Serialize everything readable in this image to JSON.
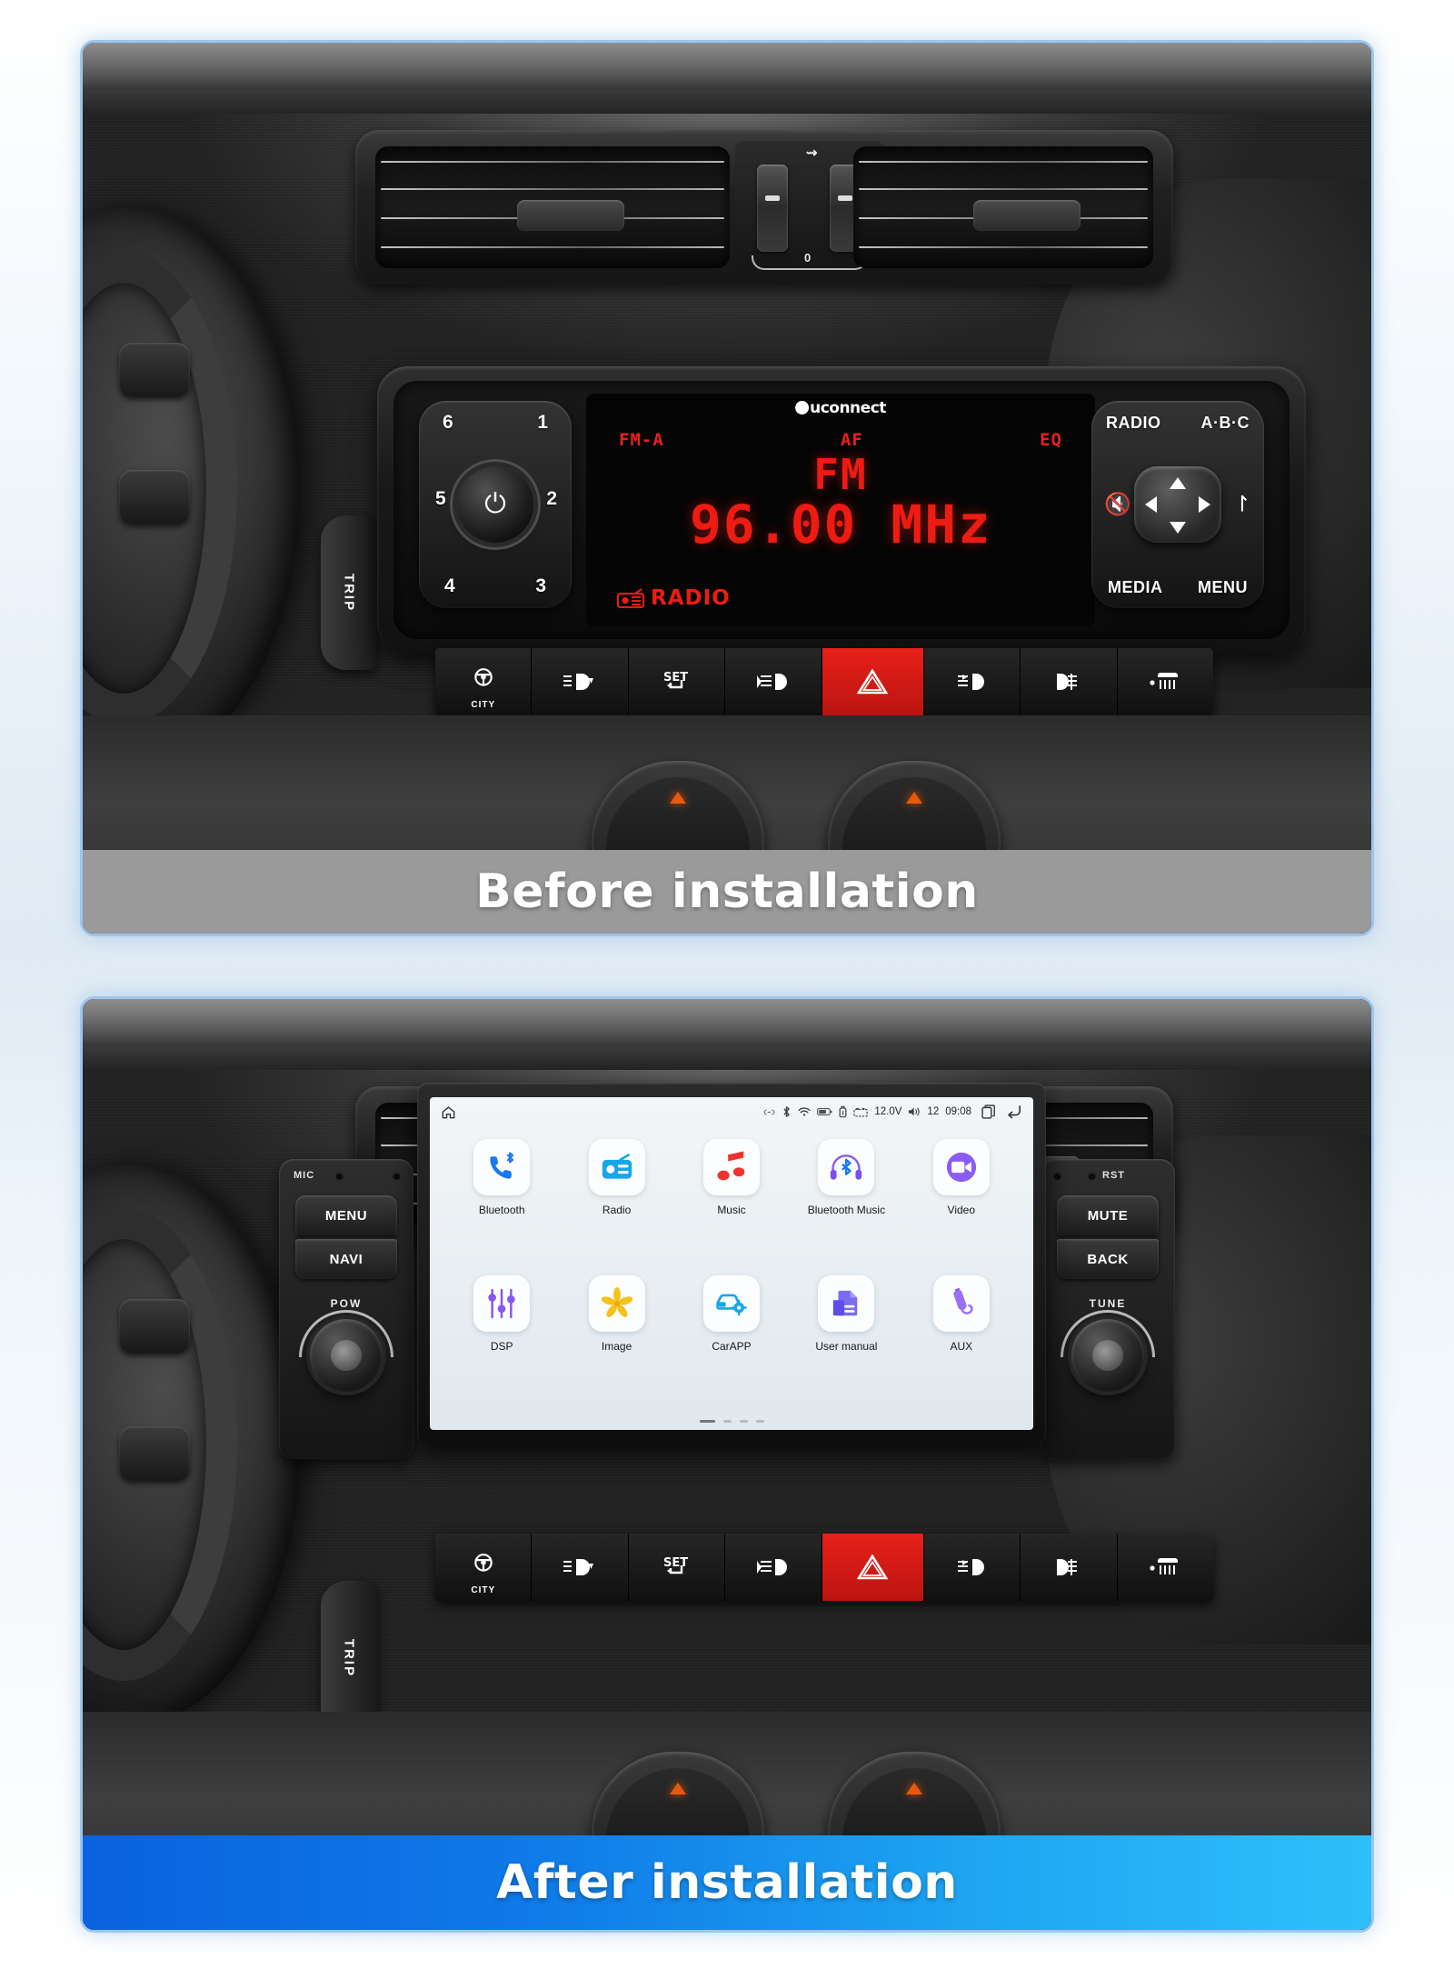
{
  "captions": {
    "before": "Before installation",
    "after": "After installation"
  },
  "colors": {
    "card_border": "#9cc6ee",
    "caption_before_bg": "#9a9a9a",
    "caption_after_bg_start": "#0a62e0",
    "caption_after_bg_end": "#2ec0fb",
    "lcd_red": "#ee1b12",
    "hazard_red": "#e8201a"
  },
  "stock_radio": {
    "brand": "uconnect",
    "display": {
      "tags": [
        "FM-A",
        "AF",
        "EQ"
      ],
      "band": "FM",
      "frequency": "96.00 MHz",
      "source_label": "RADIO"
    },
    "preset_numbers": [
      "1",
      "2",
      "3",
      "4",
      "5",
      "6"
    ],
    "nav_buttons": {
      "top_left": "RADIO",
      "top_right": "A·B·C",
      "bottom_left": "MEDIA",
      "bottom_right": "MENU"
    },
    "trip_label": "TRIP"
  },
  "dash_buttons": [
    {
      "name": "city-steering-button",
      "sub": "CITY"
    },
    {
      "name": "headlight-leveling-button",
      "sub": ""
    },
    {
      "name": "set-button",
      "sub": ""
    },
    {
      "name": "rear-fog-light-button",
      "sub": ""
    },
    {
      "name": "hazard-button",
      "sub": ""
    },
    {
      "name": "front-fog-light-button",
      "sub": ""
    },
    {
      "name": "rear-fog-button",
      "sub": ""
    },
    {
      "name": "rear-defogger-button",
      "sub": ""
    }
  ],
  "head_unit": {
    "statusbar": {
      "home_icon": "home-icon",
      "icons": [
        "link-icon",
        "bluetooth-icon",
        "wifi-icon",
        "battery-icon",
        "usb-icon"
      ],
      "voltage": "12.0V",
      "volume": "12",
      "time": "09:08",
      "recents_icon": "recents-icon",
      "back_icon": "back-icon"
    },
    "apps": [
      {
        "label": "Bluetooth",
        "icon": "bluetooth-phone-icon"
      },
      {
        "label": "Radio",
        "icon": "radio-icon"
      },
      {
        "label": "Music",
        "icon": "music-note-icon"
      },
      {
        "label": "Bluetooth Music",
        "icon": "bluetooth-headphones-icon"
      },
      {
        "label": "Video",
        "icon": "video-camera-icon"
      },
      {
        "label": "DSP",
        "icon": "equalizer-icon"
      },
      {
        "label": "Image",
        "icon": "flower-image-icon"
      },
      {
        "label": "CarAPP",
        "icon": "car-settings-icon"
      },
      {
        "label": "User manual",
        "icon": "document-icon"
      },
      {
        "label": "AUX",
        "icon": "aux-cable-icon"
      }
    ],
    "page_dots": 4,
    "active_page": 1,
    "left_pod": {
      "mic_label": "MIC",
      "button_top": "MENU",
      "button_bottom": "NAVI",
      "knob_label": "POW"
    },
    "right_pod": {
      "reset_label": "RST",
      "button_top": "MUTE",
      "button_bottom": "BACK",
      "knob_label": "TUNE"
    }
  }
}
